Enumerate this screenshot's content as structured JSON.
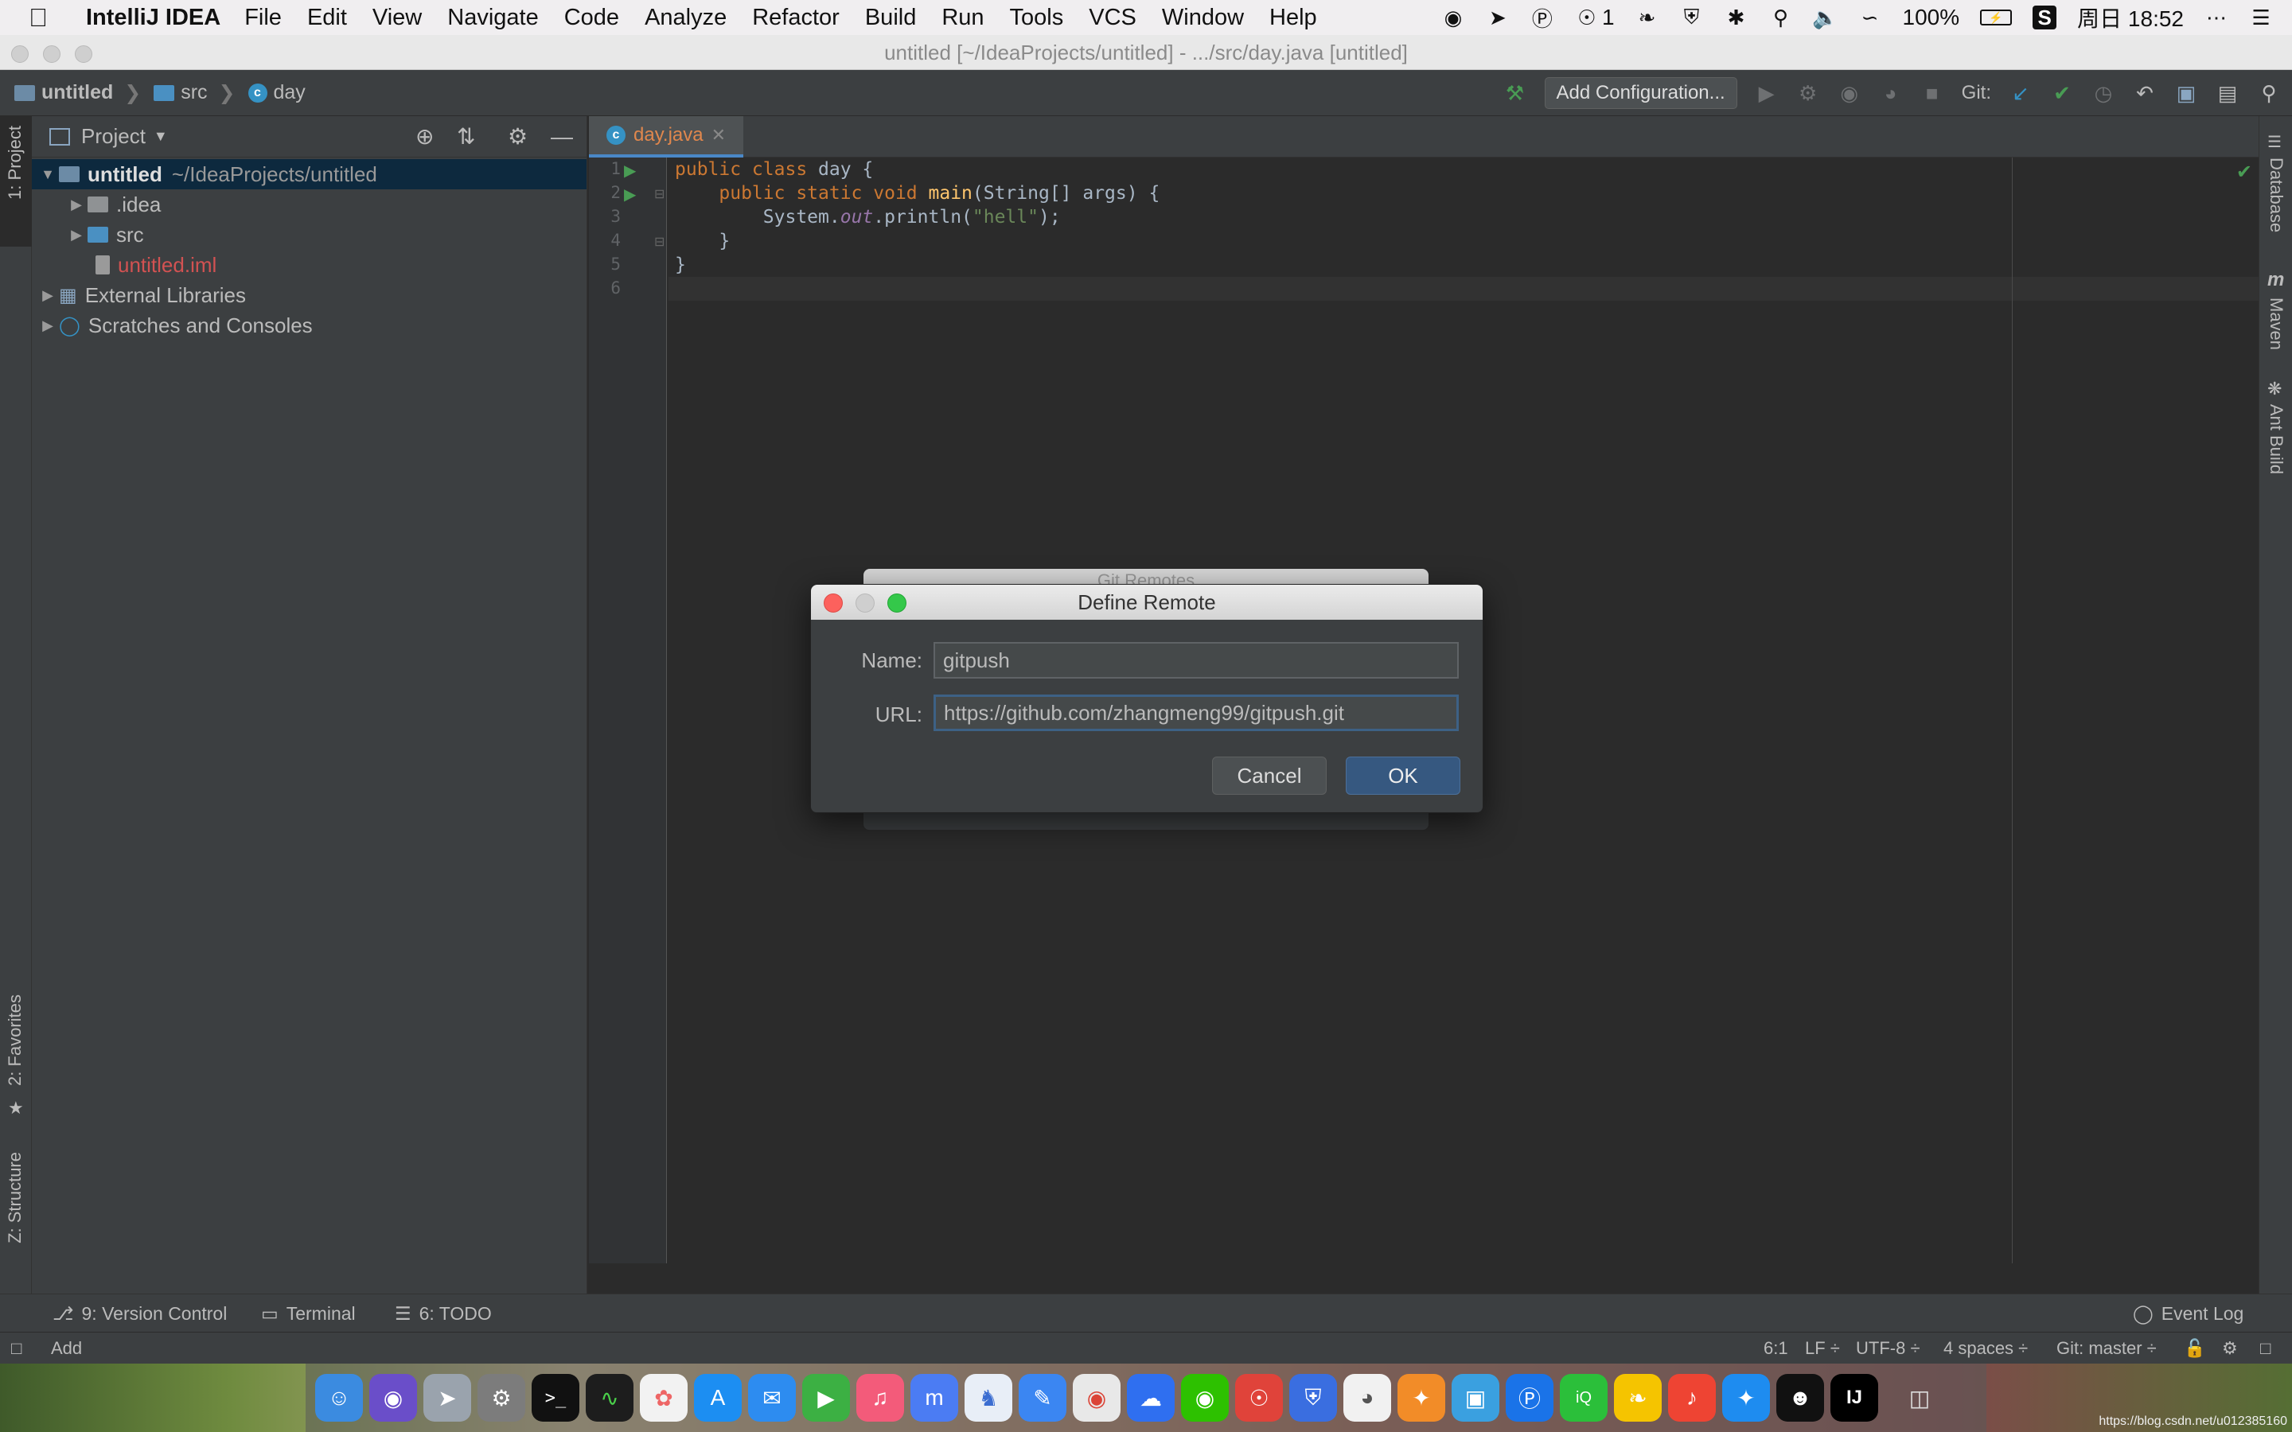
{
  "menubar": {
    "app_name": "IntelliJ IDEA",
    "items": [
      "File",
      "Edit",
      "View",
      "Navigate",
      "Code",
      "Analyze",
      "Refactor",
      "Build",
      "Run",
      "Tools",
      "VCS",
      "Window",
      "Help"
    ],
    "badge_count": "1",
    "battery": "100%",
    "clock": "周日 18:52"
  },
  "window": {
    "title": "untitled [~/IdeaProjects/untitled] - .../src/day.java [untitled]"
  },
  "navbar": {
    "crumb_project": "untitled",
    "crumb_folder": "src",
    "crumb_class": "day",
    "add_config": "Add Configuration...",
    "git_label": "Git:"
  },
  "left_stripe": {
    "project_tab": "1: Project",
    "favorites_tab": "2: Favorites",
    "structure_tab": "Z: Structure"
  },
  "project_panel": {
    "title": "Project",
    "root_name": "untitled",
    "root_path": "~/IdeaProjects/untitled",
    "nodes": [
      ".idea",
      "src",
      "untitled.iml",
      "External Libraries",
      "Scratches and Consoles"
    ]
  },
  "editor": {
    "tab_label": "day.java",
    "line_numbers": [
      "1",
      "2",
      "3",
      "4",
      "5",
      "6"
    ],
    "code": {
      "l1_kw": "public class ",
      "l1_name": "day {",
      "l2_indent": "    ",
      "l2_kw": "public static void ",
      "l2_fn": "main",
      "l2_rest": "(String[] args) {",
      "l3_indent": "        ",
      "l3_a": "System.",
      "l3_out": "out",
      "l3_b": ".println(",
      "l3_str": "\"hell\"",
      "l3_c": ");",
      "l4": "    }",
      "l5": "}"
    }
  },
  "right_stripe": {
    "database": "Database",
    "maven": "Maven",
    "ant": "Ant Build"
  },
  "git_remotes_dialog": {
    "title": "Git Remotes"
  },
  "define_remote": {
    "title": "Define Remote",
    "name_label": "Name:",
    "name_value": "gitpush",
    "url_label": "URL:",
    "url_value": "https://github.com/zhangmeng99/gitpush.git",
    "cancel": "Cancel",
    "ok": "OK"
  },
  "tool_windows": {
    "version_control": "9: Version Control",
    "terminal": "Terminal",
    "todo": "6: TODO",
    "event_log": "Event Log"
  },
  "statusbar": {
    "left_text": "Add",
    "position": "6:1",
    "line_sep": "LF ÷",
    "encoding": "UTF-8 ÷",
    "indent": "4 spaces ÷",
    "branch": "Git: master ÷"
  },
  "watermark": "https://blog.csdn.net/u012385160",
  "colors": {
    "accent": "#4a88c7",
    "keyword": "#cc7832",
    "function": "#ffc66d",
    "string": "#6a8759",
    "ok_button": "#365880"
  }
}
